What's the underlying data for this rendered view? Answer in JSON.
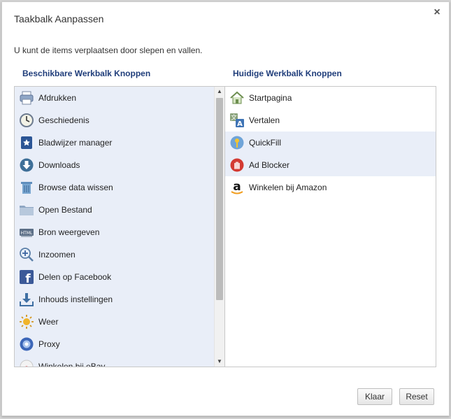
{
  "dialog": {
    "title": "Taakbalk Aanpassen",
    "close_glyph": "×",
    "instructions": "U kunt de items verplaatsen door slepen en vallen."
  },
  "available": {
    "header": "Beschikbare Werkbalk Knoppen",
    "items": [
      {
        "label": "Afdrukken",
        "icon": "printer-icon"
      },
      {
        "label": "Geschiedenis",
        "icon": "clock-icon"
      },
      {
        "label": "Bladwijzer manager",
        "icon": "bookmark-star-icon"
      },
      {
        "label": "Downloads",
        "icon": "download-arrow-icon"
      },
      {
        "label": "Browse data wissen",
        "icon": "trash-icon"
      },
      {
        "label": "Open Bestand",
        "icon": "folder-icon"
      },
      {
        "label": "Bron weergeven",
        "icon": "html-source-icon"
      },
      {
        "label": "Inzoomen",
        "icon": "zoom-in-icon"
      },
      {
        "label": "Delen op Facebook",
        "icon": "facebook-icon"
      },
      {
        "label": "Inhouds instellingen",
        "icon": "download-tray-icon"
      },
      {
        "label": "Weer",
        "icon": "weather-sun-icon"
      },
      {
        "label": "Proxy",
        "icon": "proxy-icon"
      },
      {
        "label": "Winkelen bij eBay",
        "icon": "ebay-icon"
      }
    ]
  },
  "current": {
    "header": "Huidige Werkbalk Knoppen",
    "items": [
      {
        "label": "Startpagina",
        "icon": "home-icon"
      },
      {
        "label": "Vertalen",
        "icon": "translate-icon"
      },
      {
        "label": "QuickFill",
        "icon": "key-icon",
        "highlighted": true
      },
      {
        "label": "Ad Blocker",
        "icon": "stop-hand-icon",
        "highlighted": true
      },
      {
        "label": "Winkelen bij Amazon",
        "icon": "amazon-icon"
      }
    ]
  },
  "scroll": {
    "up": "▲",
    "down": "▼"
  },
  "buttons": {
    "done": "Klaar",
    "reset": "Reset"
  },
  "colors": {
    "header_blue": "#1f3d7a",
    "left_panel_bg": "#e9eef8",
    "highlight_bg": "#e9eef8"
  }
}
